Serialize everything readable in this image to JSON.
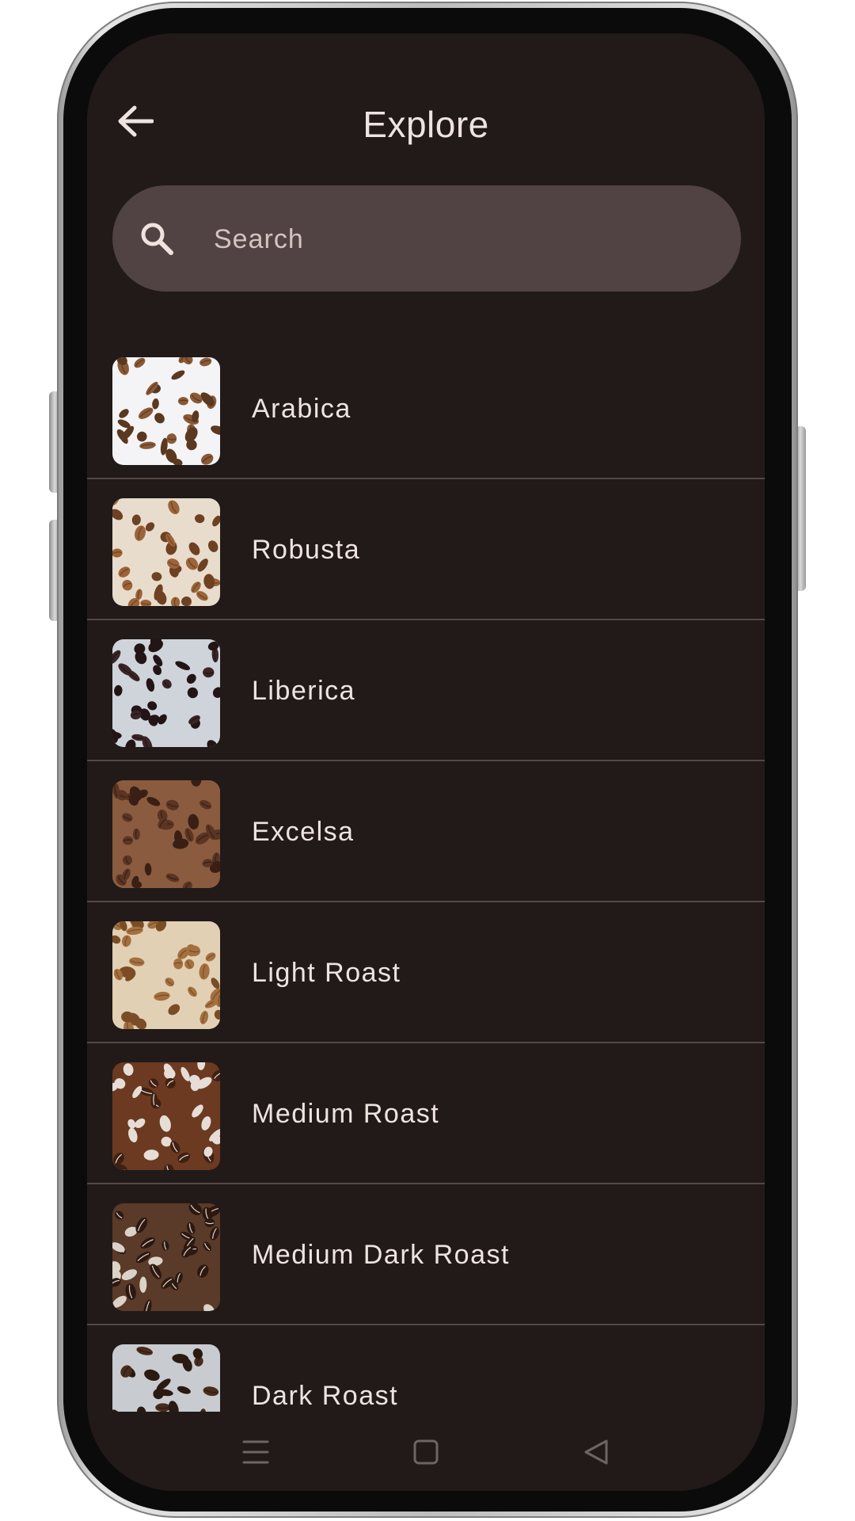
{
  "header": {
    "title": "Explore",
    "back_icon": "arrow-back-icon"
  },
  "search": {
    "placeholder": "Search",
    "value": "",
    "icon": "search-icon"
  },
  "items": [
    {
      "label": "Arabica",
      "thumb_colors": [
        "#f4f4f6",
        "#8a5a36",
        "#5b3820"
      ]
    },
    {
      "label": "Robusta",
      "thumb_colors": [
        "#e8dccd",
        "#9c6438",
        "#6d4122"
      ]
    },
    {
      "label": "Liberica",
      "thumb_colors": [
        "#cfd4db",
        "#3a2526",
        "#231516"
      ]
    },
    {
      "label": "Excelsa",
      "thumb_colors": [
        "#8a5b3e",
        "#5b3523",
        "#3a1f14"
      ]
    },
    {
      "label": "Light Roast",
      "thumb_colors": [
        "#e2d0b4",
        "#a4703f",
        "#7a4d26"
      ]
    },
    {
      "label": "Medium Roast",
      "thumb_colors": [
        "#6b3a20",
        "#3e2013",
        "#e6ddd6"
      ]
    },
    {
      "label": "Medium Dark Roast",
      "thumb_colors": [
        "#5a3a28",
        "#2c1810",
        "#dcd3c8"
      ]
    },
    {
      "label": "Dark Roast",
      "thumb_colors": [
        "#c8ccd0",
        "#4a2c1c",
        "#2b1a12"
      ]
    }
  ],
  "nav": {
    "menu_icon": "menu-icon",
    "home_icon": "home-square-icon",
    "back_icon": "back-triangle-icon"
  },
  "colors": {
    "background": "#211a19",
    "search_fill": "#514343",
    "text": "#efe3e0",
    "divider": "#544847"
  }
}
